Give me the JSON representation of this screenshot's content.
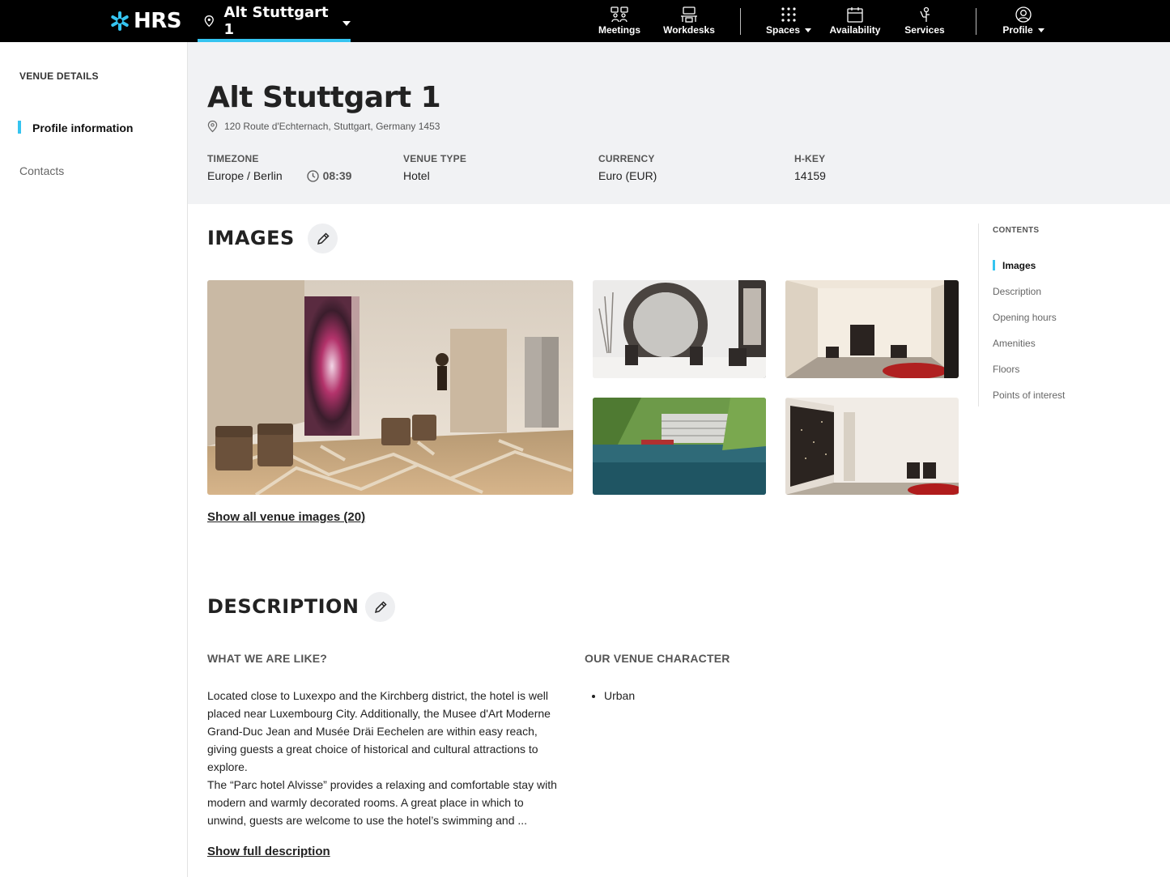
{
  "nav": {
    "brand": "HRS",
    "venue_name": "Alt Stuttgart 1",
    "items": [
      {
        "label": "Meetings",
        "icon": "meetings-icon"
      },
      {
        "label": "Workdesks",
        "icon": "workdesks-icon"
      },
      {
        "label": "Spaces",
        "icon": "spaces-grid-icon"
      },
      {
        "label": "Availability",
        "icon": "calendar-icon"
      },
      {
        "label": "Services",
        "icon": "services-icon"
      },
      {
        "label": "Profile",
        "icon": "user-circle-icon"
      }
    ],
    "accent_color": "#35c4f0"
  },
  "sidebar": {
    "section_title": "VENUE DETAILS",
    "items": [
      {
        "label": "Profile information",
        "active": true
      },
      {
        "label": "Contacts",
        "active": false
      }
    ]
  },
  "header": {
    "title": "Alt Stuttgart 1",
    "address": "120 Route d'Echternach, Stuttgart, Germany 1453",
    "timezone_label": "TIMEZONE",
    "timezone_value": "Europe / Berlin",
    "local_time": "08:39",
    "venue_type_label": "VENUE TYPE",
    "venue_type_value": "Hotel",
    "currency_label": "CURRENCY",
    "currency_value": "Euro (EUR)",
    "hkey_label": "H-KEY",
    "hkey_value": "14159"
  },
  "images": {
    "title": "IMAGES",
    "show_all": "Show all venue images (20)"
  },
  "description": {
    "title": "DESCRIPTION",
    "what_heading": "WHAT WE ARE LIKE?",
    "paragraph_1": "Located close to Luxexpo and the Kirchberg district, the hotel is well placed near Luxembourg City. Additionally, the Musee d'Art Moderne Grand-Duc Jean and Musée Dräi Eechelen are within easy reach, giving guests a great choice of historical and cultural attractions to explore.",
    "paragraph_2": "The “Parc hotel Alvisse” provides a relaxing and comfortable stay with modern and warmly decorated rooms. A great place in which to unwind, guests are welcome to use the hotel’s swimming and ...",
    "character_heading": "OUR VENUE CHARACTER",
    "characters": [
      "Urban"
    ],
    "show_full": "Show full description"
  },
  "contents": {
    "title": "CONTENTS",
    "items": [
      "Images",
      "Description",
      "Opening hours",
      "Amenities",
      "Floors",
      "Points of interest"
    ]
  }
}
